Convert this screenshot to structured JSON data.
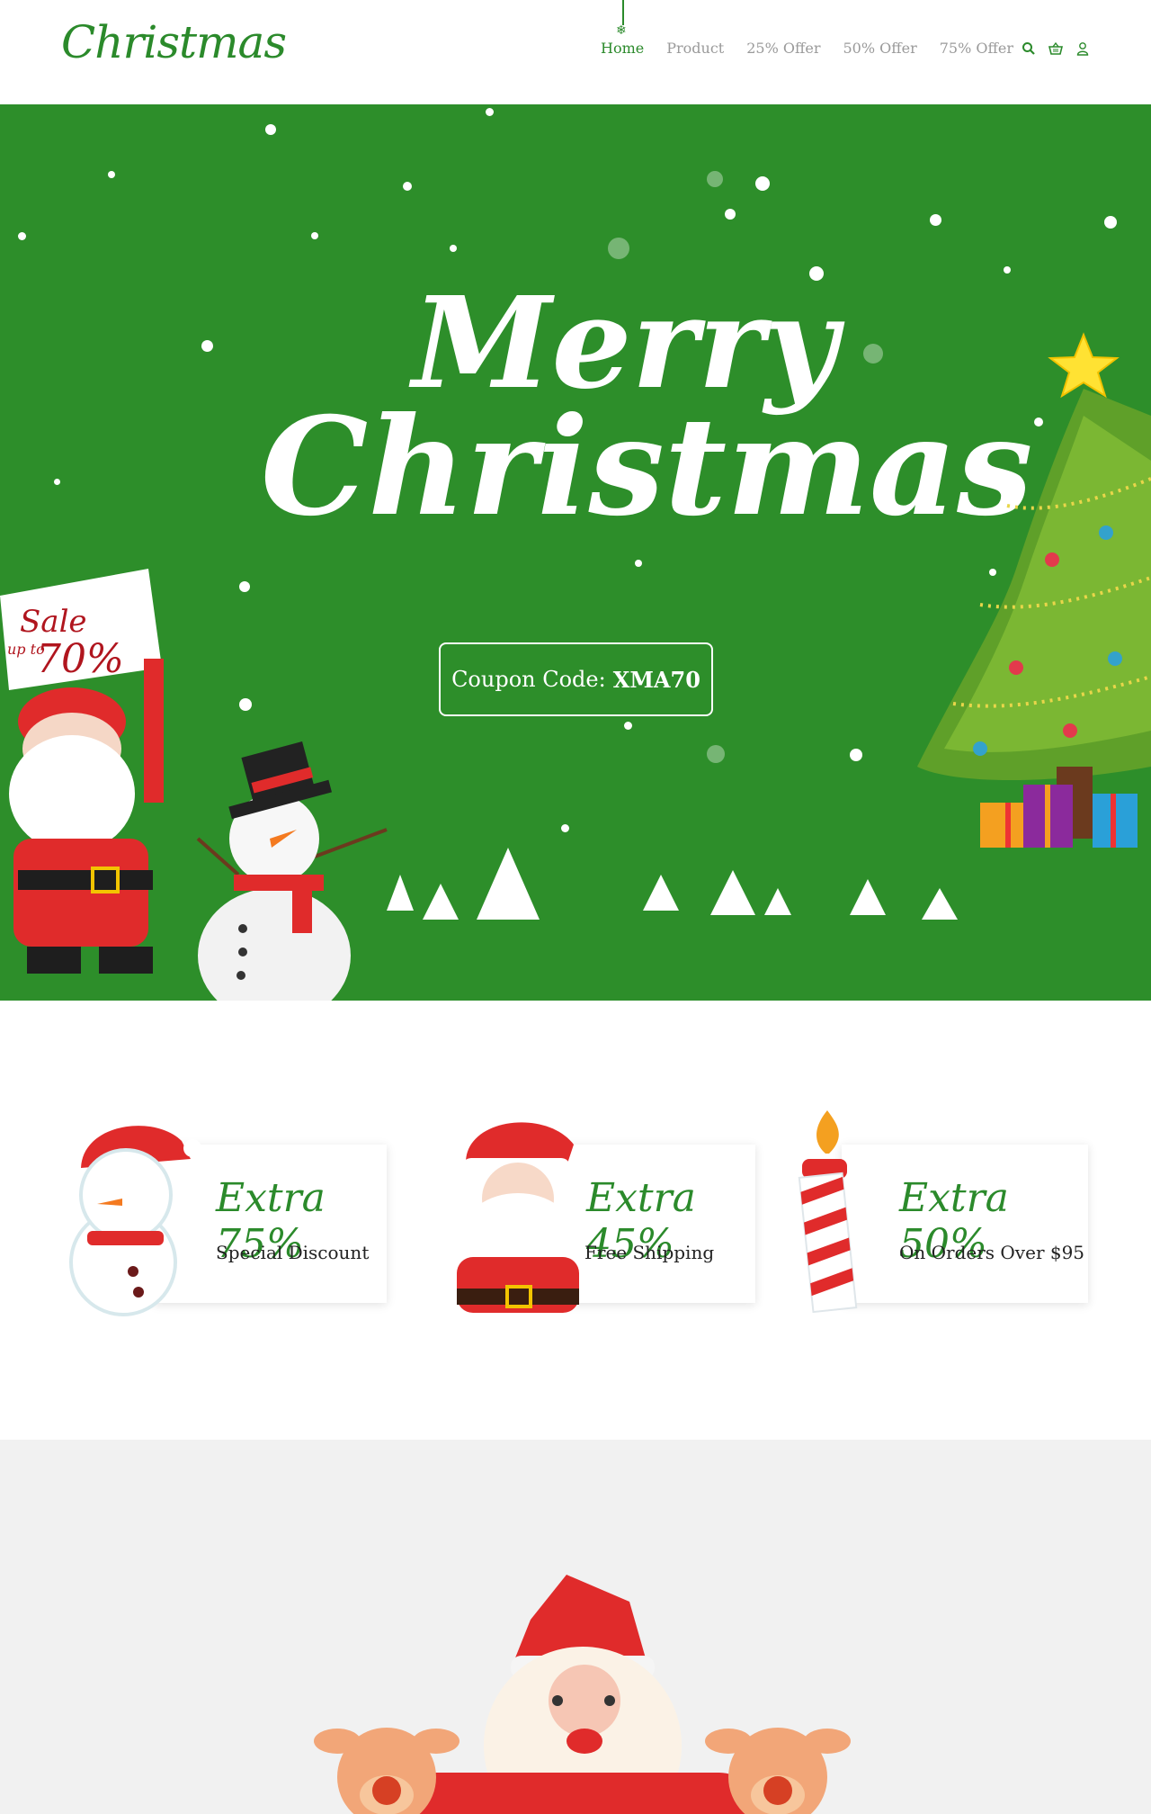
{
  "header": {
    "logo_text": "Christmas",
    "nav": [
      {
        "label": "Home",
        "active": true
      },
      {
        "label": "Product",
        "active": false
      },
      {
        "label": "25% Offer",
        "active": false
      },
      {
        "label": "50% Offer",
        "active": false
      },
      {
        "label": "75% Offer",
        "active": false
      }
    ],
    "icons": [
      "search-icon",
      "basket-icon",
      "user-icon"
    ]
  },
  "hero": {
    "title_line1": "Merry",
    "title_line2": "Christmas",
    "coupon_label": "Coupon Code:",
    "coupon_code": "XMA70",
    "sale_sign": {
      "line1": "Sale",
      "line2": "up to",
      "line3": "70%"
    }
  },
  "features": [
    {
      "title": "Extra 75%",
      "subtitle": "Special Discount",
      "icon": "snowman-icon"
    },
    {
      "title": "Extra 45%",
      "subtitle": "Free Shipping",
      "icon": "santa-icon"
    },
    {
      "title": "Extra 50%",
      "subtitle": "On Orders Over $95",
      "icon": "candle-icon"
    }
  ],
  "colors": {
    "brand_green": "#2b8a2b",
    "hero_green": "#2d8e2a",
    "nav_gray": "#9a9a9a",
    "bottom_bg": "#f1f1f1"
  }
}
